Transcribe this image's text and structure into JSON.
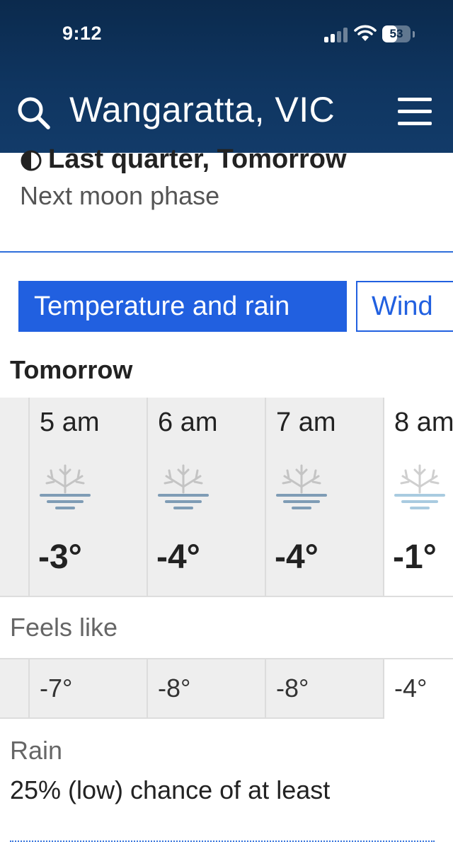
{
  "status_bar": {
    "time": "9:12",
    "battery": "53",
    "battery_level": 0.53
  },
  "header": {
    "location": "Wangaratta, VIC"
  },
  "moon": {
    "phase": "Last quarter, Tomorrow",
    "label": "Next moon phase"
  },
  "tabs": {
    "active": "Temperature and rain",
    "wind": "Wind"
  },
  "forecast": {
    "heading": "Tomorrow",
    "hours": [
      {
        "time": "5 am",
        "temp": "-3°",
        "icon": "frost-icon"
      },
      {
        "time": "6 am",
        "temp": "-4°",
        "icon": "frost-icon"
      },
      {
        "time": "7 am",
        "temp": "-4°",
        "icon": "frost-icon"
      },
      {
        "time": "8 am",
        "temp": "-1°",
        "icon": "frost-icon"
      }
    ]
  },
  "feels_like": {
    "heading": "Feels like",
    "values": [
      "-7°",
      "-8°",
      "-8°",
      "-4°"
    ]
  },
  "rain": {
    "heading": "Rain",
    "text": "25% (low) chance of at least"
  },
  "colors": {
    "header_bg": "#0f3560",
    "accent": "#2160e0",
    "frost_blue": "#7f9cb5",
    "frost_light": "#a9cbe0"
  }
}
